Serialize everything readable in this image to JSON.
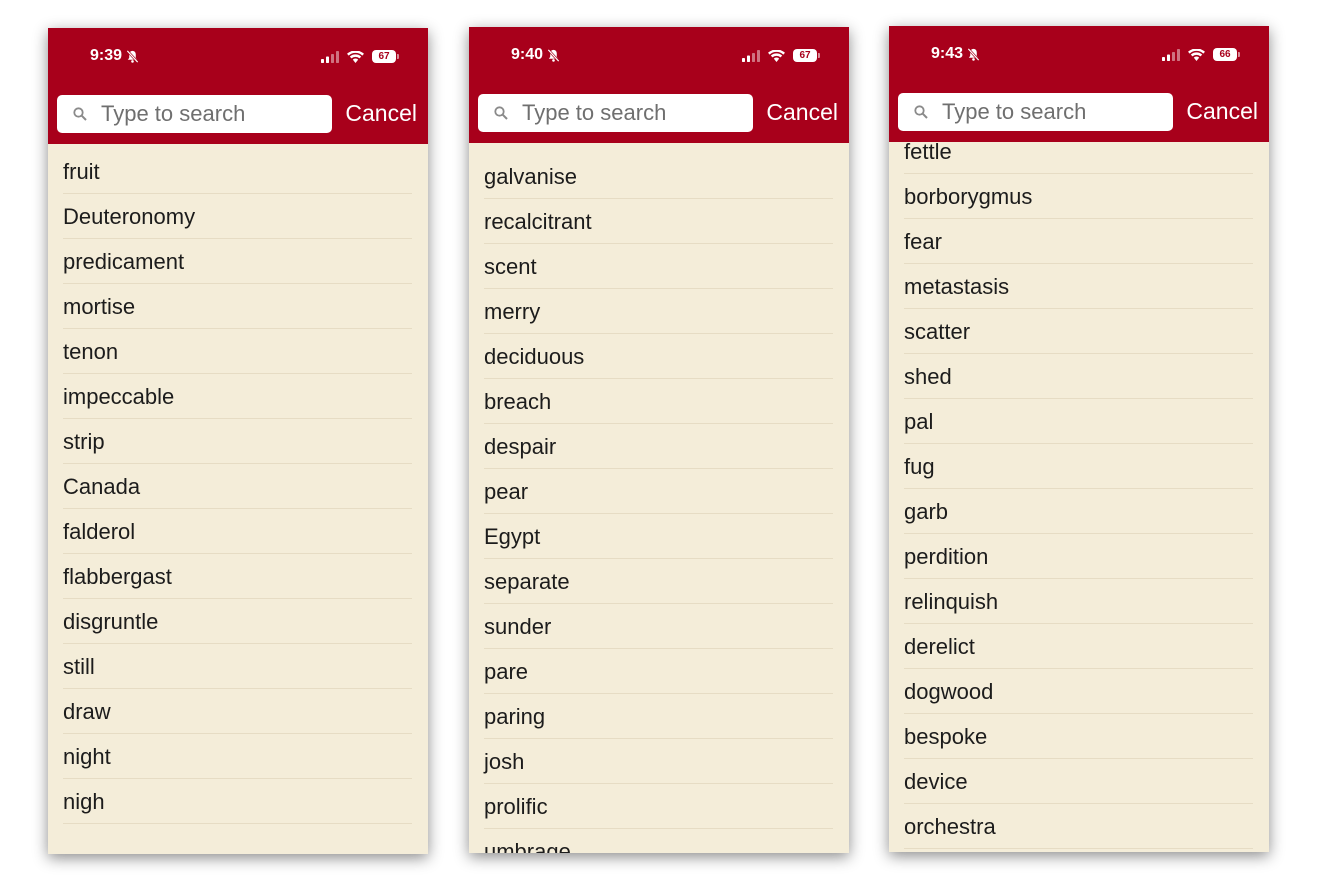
{
  "screens": [
    {
      "status": {
        "time": "9:39",
        "battery": "67"
      },
      "search": {
        "placeholder": "Type to search",
        "cancel_label": "Cancel"
      },
      "words": [
        "fruit",
        "Deuteronomy",
        "predicament",
        "mortise",
        "tenon",
        "impeccable",
        "strip",
        "Canada",
        "falderol",
        "flabbergast",
        "disgruntle",
        "still",
        "draw",
        "night",
        "nigh"
      ]
    },
    {
      "status": {
        "time": "9:40",
        "battery": "67"
      },
      "search": {
        "placeholder": "Type to search",
        "cancel_label": "Cancel"
      },
      "words": [
        "galvanise",
        "recalcitrant",
        "scent",
        "merry",
        "deciduous",
        "breach",
        "despair",
        "pear",
        "Egypt",
        "separate",
        "sunder",
        "pare",
        "paring",
        "josh",
        "prolific",
        "umbrage"
      ]
    },
    {
      "status": {
        "time": "9:43",
        "battery": "66"
      },
      "search": {
        "placeholder": "Type to search",
        "cancel_label": "Cancel"
      },
      "words": [
        "fettle",
        "borborygmus",
        "fear",
        "metastasis",
        "scatter",
        "shed",
        "pal",
        "fug",
        "garb",
        "perdition",
        "relinquish",
        "derelict",
        "dogwood",
        "bespoke",
        "device",
        "orchestra"
      ]
    }
  ],
  "theme": {
    "header": "#a8001b",
    "list_background": "#f4edd9",
    "text": "#1c1c1c"
  },
  "icons": [
    "bell-slash-icon",
    "signal-icon",
    "wifi-icon",
    "battery-icon",
    "search-icon"
  ]
}
